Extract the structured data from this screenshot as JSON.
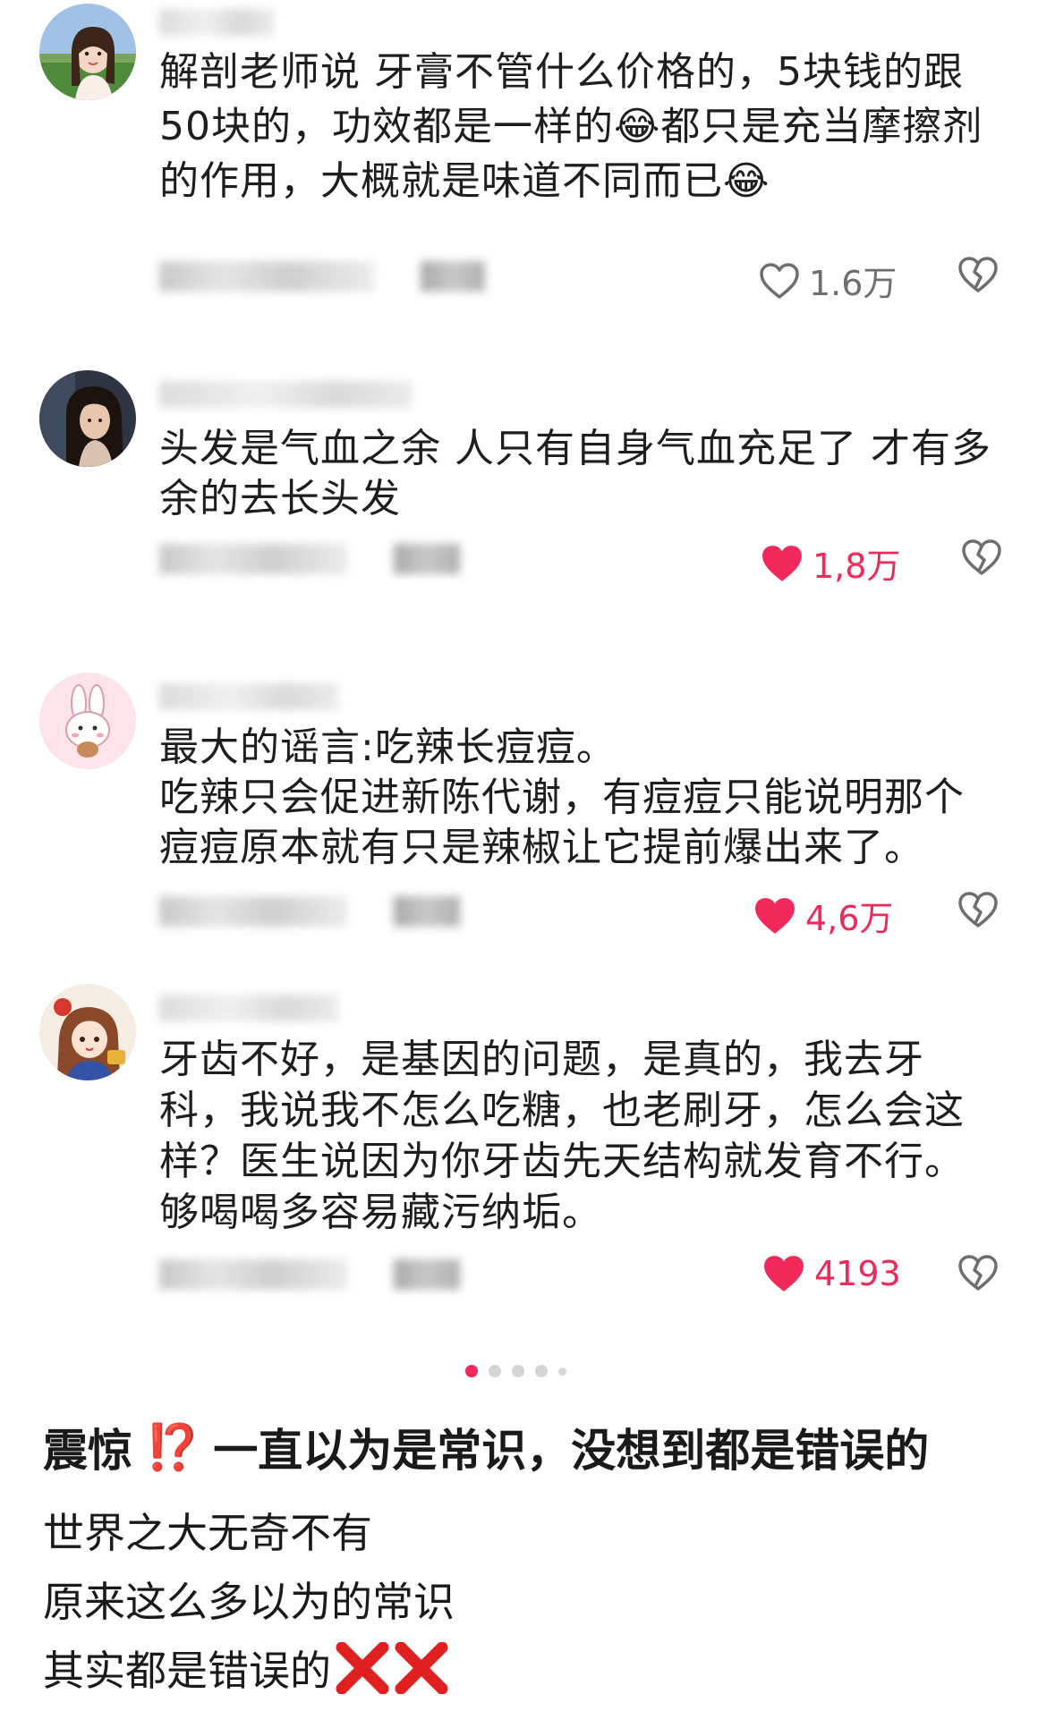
{
  "comments": [
    {
      "username": "██████",
      "avatar_icon": "user-avatar-girl-outdoors",
      "lines": [
        "解剖老师说 牙膏不管什么价格的，5块钱的跟",
        "50块的，功效都是一样的😂都只是充当摩擦剂",
        "的作用，大概就是味道不同而已😂"
      ],
      "like_count": "1.6万",
      "liked": false
    },
    {
      "username": "████████████",
      "avatar_icon": "user-avatar-woman-portrait",
      "lines": [
        "头发是气血之余 人只有自身气血充足了 才有多",
        "余的去长头发"
      ],
      "like_count": "1,8万",
      "liked": true
    },
    {
      "username": "██████",
      "avatar_icon": "user-avatar-bunny-sticker",
      "lines": [
        "最大的谣言:吃辣长痘痘。",
        "吃辣只会促进新陈代谢，有痘痘只能说明那个",
        "痘痘原本就有只是辣椒让它提前爆出来了。"
      ],
      "like_count": "4,6万",
      "liked": true
    },
    {
      "username": "██████",
      "avatar_icon": "user-avatar-anime-girl",
      "lines": [
        "牙齿不好，是基因的问题，是真的，我去牙",
        "科，我说我不怎么吃糖，也老刷牙，怎么会这",
        "样？医生说因为你牙齿先天结构就发育不行。",
        "够喝喝多容易藏污纳垢。"
      ],
      "like_count": "4193",
      "liked": true
    }
  ],
  "colors": {
    "like_active": "#f0295a",
    "like_inactive": "#6e6e6e",
    "text": "#1e1e1e",
    "x_mark": "#e02020"
  },
  "pagination": {
    "current": 1,
    "total_visible": 5
  },
  "post": {
    "title_prefix": "震惊",
    "title_emoji": "⁉️",
    "title_suffix": "一直以为是常识，没想到都是错误的",
    "body_lines": [
      "世界之大无奇不有",
      "原来这么多以为的常识",
      "其实都是错误的"
    ],
    "end_icons": [
      "x-mark-icon",
      "x-mark-icon"
    ]
  }
}
